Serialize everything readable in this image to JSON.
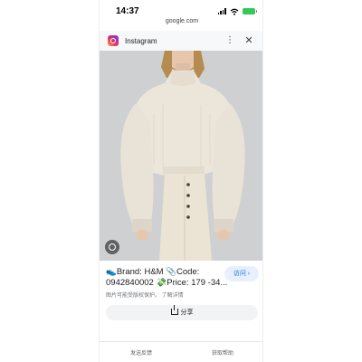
{
  "status_bar": {
    "time": "14:37"
  },
  "browser": {
    "url": "google.com"
  },
  "sheet": {
    "source_name": "Instagram",
    "more_icon": "more-vert-icon",
    "close_icon": "close-icon"
  },
  "image": {
    "description_icon": "lens-icon"
  },
  "result": {
    "caption_line1": "👟Brand: H&M 📎Code:",
    "caption_line2": "0942840002 💸Price: 179 -34...",
    "copyright_note": "图片可能受版权保护。 了解详情",
    "visit_label": "访问 ›",
    "share_label": "分享"
  },
  "footer": {
    "feedback": "发送反馈",
    "help": "获取帮助"
  },
  "colors": {
    "accent": "#1a73e8",
    "visit_bg": "#e8f0fe",
    "battery": "#34c759"
  }
}
